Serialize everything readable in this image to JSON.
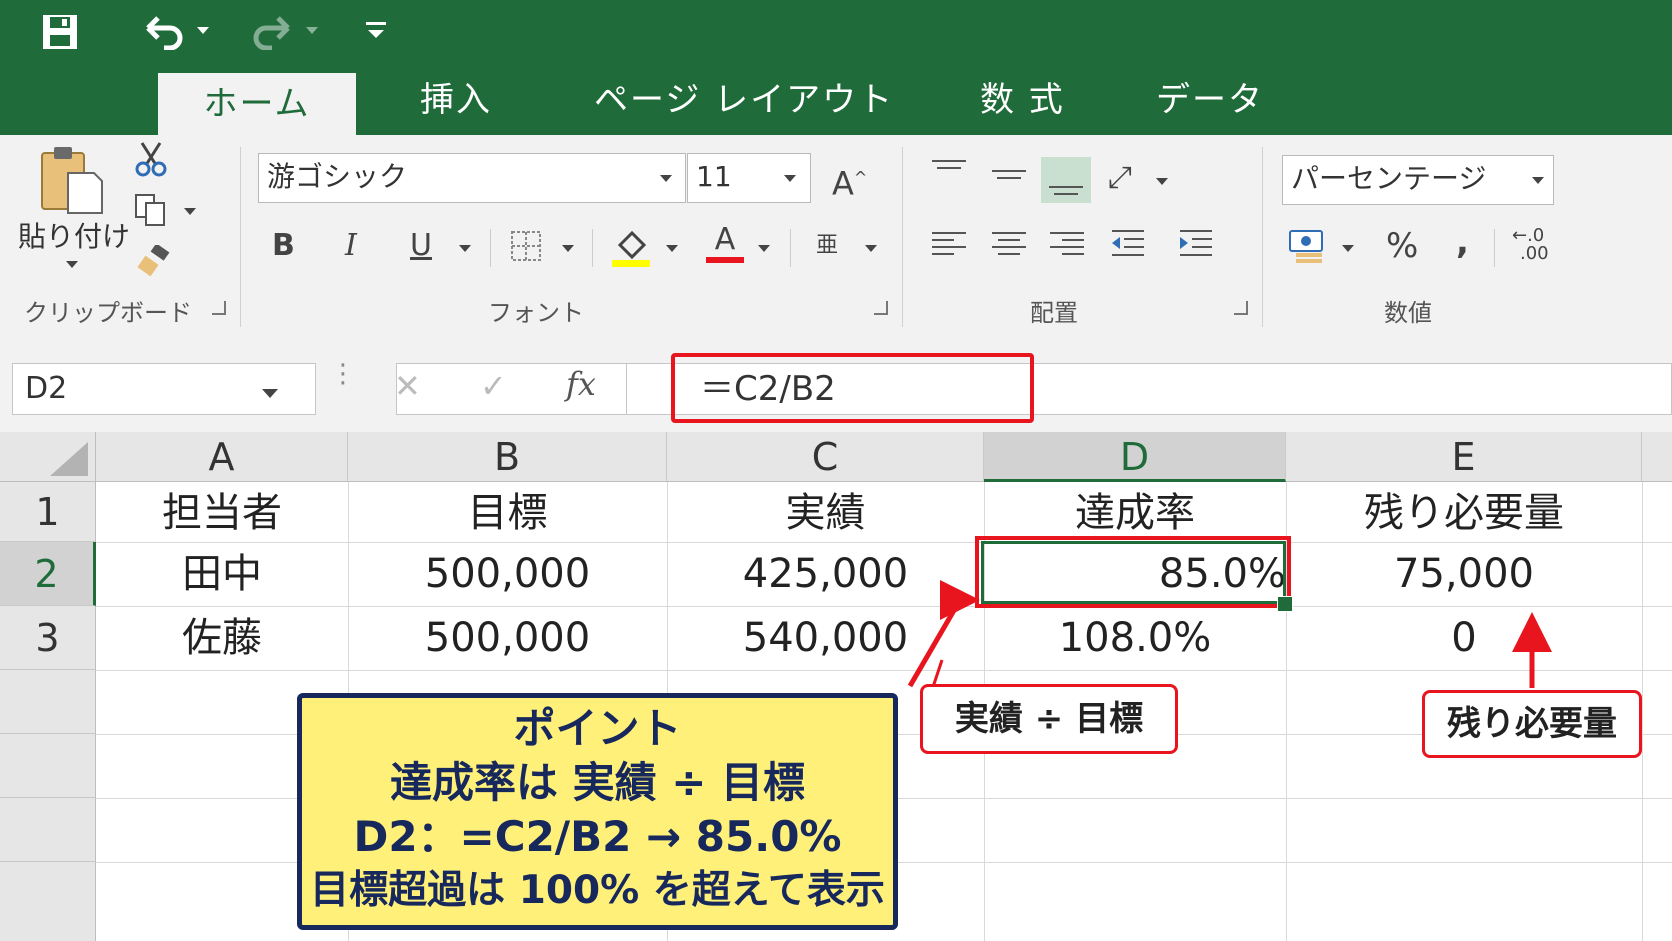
{
  "quick_access": {
    "save_icon": "save-icon",
    "undo_icon": "undo-icon",
    "redo_icon": "redo-icon",
    "customize_icon": "customize-qat-icon"
  },
  "tabs": [
    {
      "label": "ホーム",
      "active": true
    },
    {
      "label": "挿入"
    },
    {
      "label": "ページ レイアウト"
    },
    {
      "label": "数 式"
    },
    {
      "label": "データ"
    }
  ],
  "ribbon": {
    "clipboard": {
      "paste_label": "貼り付け",
      "group_label": "クリップボード"
    },
    "font": {
      "font_name": "游ゴシック",
      "font_size": "11",
      "grow_font_glyph": "A",
      "bold_glyph": "B",
      "italic_glyph": "I",
      "underline_glyph": "U",
      "font_color_glyph": "A",
      "phonetic_glyph": "亜",
      "group_label": "フォント",
      "highlight_color": "#ffff00",
      "font_color": "#e8141e"
    },
    "alignment": {
      "group_label": "配置"
    },
    "number": {
      "format": "パーセンテージ",
      "percent_glyph": "%",
      "comma_glyph": ",",
      "decimal_glyph_top": "←.0",
      "decimal_glyph_bottom": ".00",
      "group_label": "数値"
    }
  },
  "formula_bar": {
    "name_box": "D2",
    "cancel_glyph": "✕",
    "enter_glyph": "✓",
    "fx_glyph": "fx",
    "formula": "＝C2/B2"
  },
  "sheet": {
    "columns": [
      "A",
      "B",
      "C",
      "D",
      "E"
    ],
    "rows": [
      "1",
      "2",
      "3"
    ],
    "cells": [
      [
        "担当者",
        "目標",
        "実績",
        "達成率",
        "残り必要量"
      ],
      [
        "田中",
        "500,000",
        "425,000",
        "85.0%",
        "75,000"
      ],
      [
        "佐藤",
        "500,000",
        "540,000",
        "108.0%",
        "0"
      ]
    ],
    "selected_cell": "D2"
  },
  "annotations": {
    "formula_callout": "実績 ÷ 目標",
    "remaining_callout": "残り必要量",
    "point_box": {
      "title": "ポイント",
      "line1": "達成率は 実績 ÷ 目標",
      "line2": "D2：=C2/B2 → 85.0%",
      "line3": "目標超過は 100% を超えて表示"
    }
  },
  "colors": {
    "excel_green": "#1f6b3a",
    "highlight_red": "#e8141e",
    "point_fill": "#fff07a",
    "point_border": "#17285c"
  }
}
